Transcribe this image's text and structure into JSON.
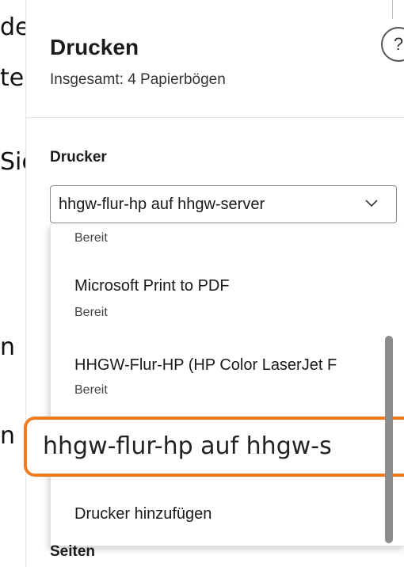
{
  "background": {
    "fragments": [
      "der",
      "ter",
      "Sie",
      "n",
      "n"
    ]
  },
  "dialog": {
    "title": "Drucken",
    "subtitle": "Insgesamt: 4 Papierbögen",
    "help_label": "?"
  },
  "printer_section": {
    "label": "Drucker",
    "selected": "hhgw-flur-hp auf hhgw-server",
    "options": [
      {
        "name": "",
        "status": "Bereit"
      },
      {
        "name": "Microsoft Print to PDF",
        "status": "Bereit"
      },
      {
        "name": "HHGW-Flur-HP (HP Color LaserJet F",
        "status": "Bereit"
      },
      {
        "name": "hhgw-flur-hp auf hhgw-s",
        "status": ""
      }
    ],
    "add_printer": "Drucker hinzufügen"
  },
  "pages_section": {
    "label": "Seiten"
  },
  "colors": {
    "highlight": "#f07c21",
    "scrollbar": "#8c8c8c"
  }
}
